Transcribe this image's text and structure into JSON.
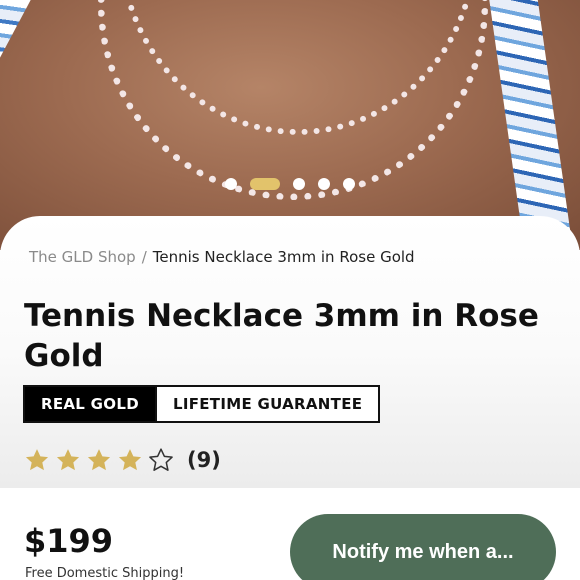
{
  "carousel": {
    "slide_count": 5,
    "active_index": 1
  },
  "breadcrumb": {
    "home": "The GLD Shop",
    "separator": "/",
    "current": "Tennis Necklace 3mm in Rose Gold"
  },
  "product": {
    "title": "Tennis Necklace 3mm in Rose Gold",
    "badges": [
      "REAL GOLD",
      "LIFETIME GUARANTEE"
    ],
    "rating": {
      "value": 4,
      "max": 5,
      "count_label": "(9)"
    },
    "price": "$199",
    "shipping_note": "Free Domestic Shipping!"
  },
  "actions": {
    "notify_label": "Notify me when a..."
  },
  "colors": {
    "star_filled": "#D4B35A",
    "star_empty": "#333333",
    "notify_bg": "#4F6E58",
    "carousel_active": "#E2C36B"
  },
  "icons": {
    "star": "star-icon"
  }
}
